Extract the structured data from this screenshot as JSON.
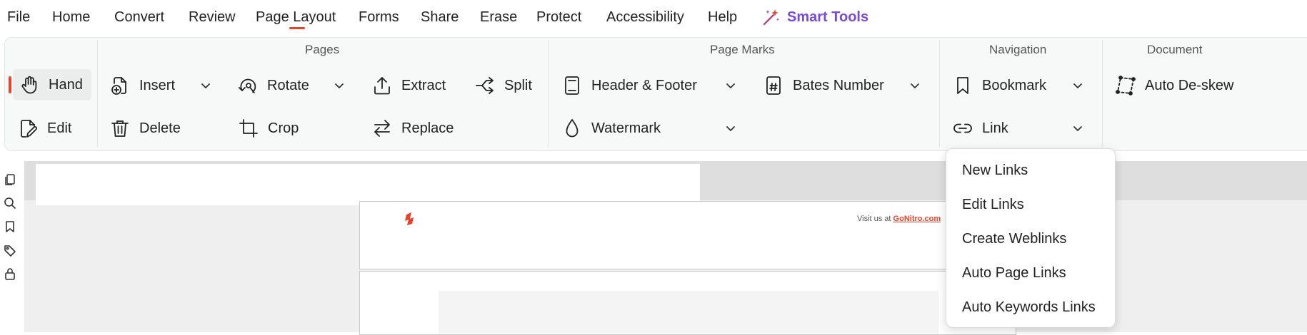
{
  "menu": {
    "items": [
      "File",
      "Home",
      "Convert",
      "Review",
      "Page Layout",
      "Forms",
      "Share",
      "Erase",
      "Protect",
      "Accessibility",
      "Help"
    ],
    "smart_tools": "Smart Tools",
    "active": "Page Layout"
  },
  "ribbon": {
    "groups": {
      "pages": "Pages",
      "page_marks": "Page Marks",
      "navigation": "Navigation",
      "document": "Document"
    },
    "buttons": {
      "hand": "Hand",
      "edit": "Edit",
      "insert": "Insert",
      "delete": "Delete",
      "rotate": "Rotate",
      "crop": "Crop",
      "extract": "Extract",
      "replace": "Replace",
      "split": "Split",
      "header_footer": "Header & Footer",
      "watermark": "Watermark",
      "bates_number": "Bates Number",
      "bookmark": "Bookmark",
      "link": "Link",
      "auto_deskew": "Auto De-skew"
    }
  },
  "document": {
    "visit_text": "Visit us at ",
    "visit_link": "GoNitro.com"
  },
  "link_menu": {
    "items": [
      "New Links",
      "Edit Links",
      "Create Weblinks",
      "Auto Page Links",
      "Auto Keywords Links"
    ]
  },
  "colors": {
    "accent": "#e8432a",
    "smart_tools": "#7a4ad8"
  }
}
